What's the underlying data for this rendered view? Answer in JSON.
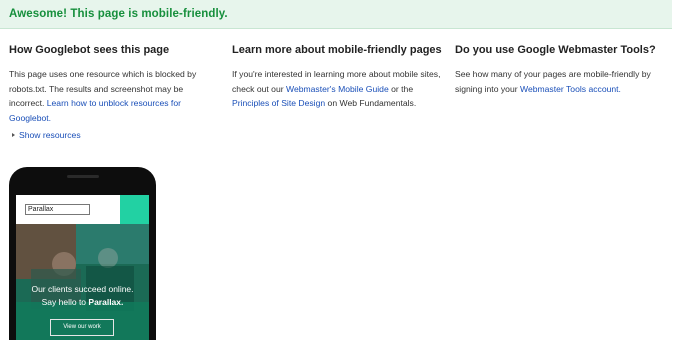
{
  "banner": {
    "message": "Awesome! This page is mobile-friendly."
  },
  "googlebot": {
    "title": "How Googlebot sees this page",
    "text": "This page uses one resource which is blocked by robots.txt. The results and screenshot may be incorrect.",
    "link": "Learn how to unblock resources for Googlebot."
  },
  "learn_more": {
    "title": "Learn more about mobile-friendly pages",
    "text_before": "If you're interested in learning more about mobile sites, check out our",
    "link1": "Webmaster's Mobile Guide",
    "text_middle": "or the",
    "link2": "Principles of Site Design",
    "text_after": "on Web Fundamentals."
  },
  "webmaster": {
    "title": "Do you use Google Webmaster Tools?",
    "text": "See how many of your pages are mobile-friendly by signing into your",
    "link": "Webmaster Tools account."
  },
  "show_resources": "Show resources",
  "preview": {
    "input_value": "Parallax",
    "hero_line1": "Our clients succeed online.",
    "hero_line2_prefix": "Say hello to",
    "hero_brand": "Parallax.",
    "button": "View our work"
  },
  "colors": {
    "banner_bg": "#e7f5ec",
    "banner_text": "#168f3c",
    "link": "#1a4fb8",
    "accent": "#22d1a3"
  }
}
